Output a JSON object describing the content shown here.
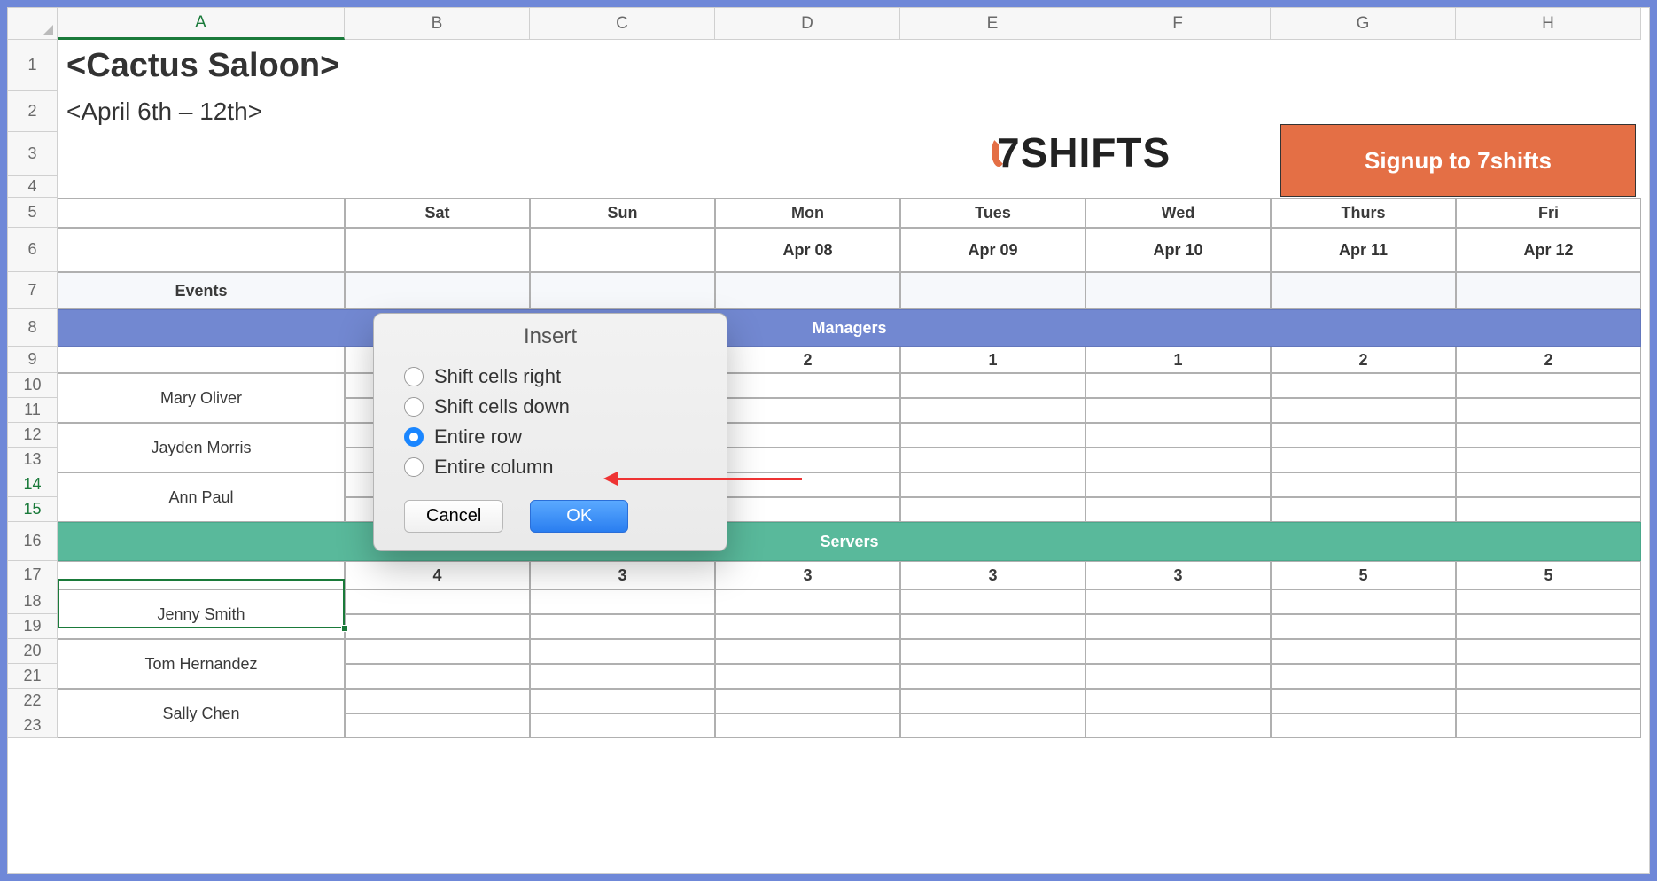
{
  "header": {
    "title": "<Cactus Saloon>",
    "subtitle": "<April 6th – 12th>",
    "logo_text": "7SHIFTS",
    "signup_label": "Signup to 7shifts"
  },
  "columns": [
    "A",
    "B",
    "C",
    "D",
    "E",
    "F",
    "G",
    "H"
  ],
  "row_numbers": [
    1,
    2,
    3,
    4,
    5,
    6,
    7,
    8,
    9,
    10,
    11,
    12,
    13,
    14,
    15,
    16,
    17,
    18,
    19,
    20,
    21,
    22,
    23
  ],
  "days": [
    "Sat",
    "Sun",
    "Mon",
    "Tues",
    "Wed",
    "Thurs",
    "Fri"
  ],
  "dates": [
    "",
    "",
    "Apr 08",
    "Apr 09",
    "Apr 10",
    "Apr 11",
    "Apr 12"
  ],
  "events_label": "Events",
  "sections": {
    "managers": {
      "label": "Managers",
      "counts": [
        "",
        "",
        "2",
        "1",
        "1",
        "2",
        "2"
      ],
      "people": [
        "Mary Oliver",
        "Jayden Morris",
        "Ann Paul"
      ]
    },
    "servers": {
      "label": "Servers",
      "counts": [
        "4",
        "3",
        "3",
        "3",
        "3",
        "5",
        "5"
      ],
      "people": [
        "Jenny Smith",
        "Tom Hernandez",
        "Sally Chen"
      ]
    }
  },
  "dialog": {
    "title": "Insert",
    "options": [
      "Shift cells right",
      "Shift cells down",
      "Entire row",
      "Entire column"
    ],
    "selected_index": 2,
    "cancel": "Cancel",
    "ok": "OK"
  }
}
